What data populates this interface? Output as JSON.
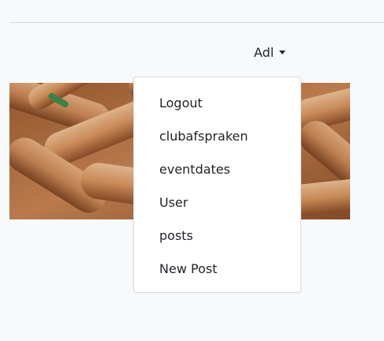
{
  "header": {
    "user_label": "Adl",
    "caret_icon": "caret-down-icon"
  },
  "menu": {
    "items": [
      {
        "label": "Logout"
      },
      {
        "label": "clubafspraken"
      },
      {
        "label": "eventdates"
      },
      {
        "label": "User"
      },
      {
        "label": "posts"
      },
      {
        "label": "New Post"
      }
    ]
  },
  "colors": {
    "background": "#f8f9fa",
    "menu_bg": "#ffffff",
    "menu_border": "#d9dcdf",
    "text": "#212529",
    "hero_tone": "#b36f3e"
  }
}
